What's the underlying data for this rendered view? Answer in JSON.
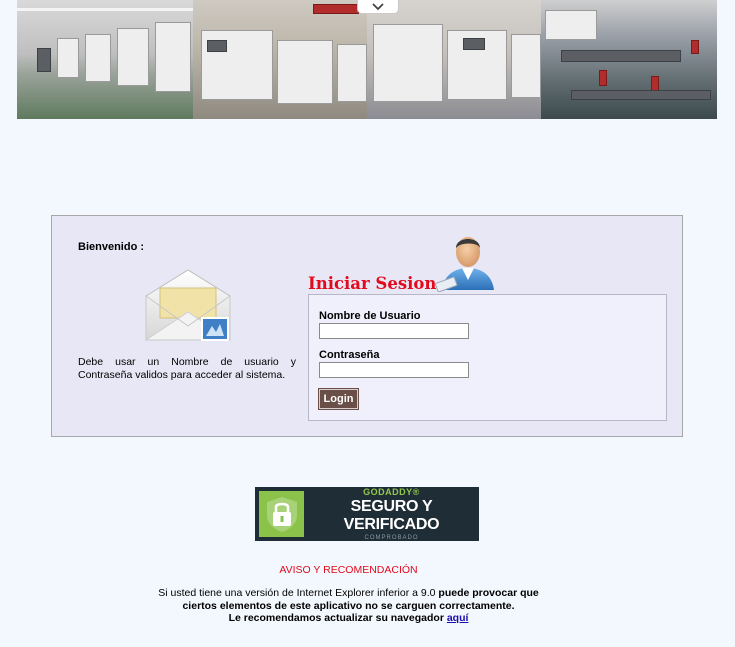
{
  "banner": {
    "panels": [
      "production-floor-1",
      "printing-machines",
      "industrial-printers",
      "assembly-line"
    ],
    "collapse_icon": "chevron-down-icon"
  },
  "login": {
    "welcome": "Bienvenido :",
    "envelope_icon": "envelope-icon",
    "info_text": "Debe usar un Nombre de usuario y Contraseña validos para acceder al sistema.",
    "title": "Iniciar Sesion",
    "avatar_icon": "user-avatar-icon",
    "username_label": "Nombre de Usuario",
    "username_value": "",
    "password_label": "Contraseña",
    "password_value": "",
    "login_button": "Login"
  },
  "seal": {
    "brand": "GODADDY®",
    "main": "SEGURO Y VERIFICADO",
    "sub": "COMPROBADO",
    "icon": "lock-icon",
    "colors": {
      "background": "#1e2d36",
      "accent": "#8bc34a"
    }
  },
  "notice": {
    "title": "AVISO Y RECOMENDACIÓN",
    "line1_prefix": "Si usted tiene una versión de Internet Explorer inferior a 9.0",
    "line1_suffix": "puede provocar que",
    "line2": "ciertos elementos de este aplicativo no se carguen correctamente.",
    "line3": "Le recomendamos actualizar su navegador",
    "link": "aquí"
  },
  "colors": {
    "page_bg": "#f3f8fe",
    "title_red": "#e20a1b",
    "button_bg": "#6a4e48",
    "box_bg": "#e8e7f6"
  }
}
